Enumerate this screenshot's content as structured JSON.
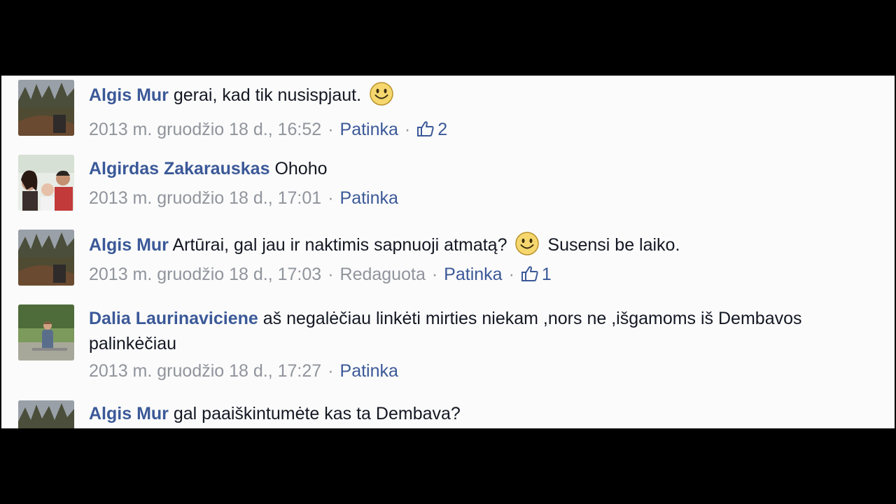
{
  "comments": [
    {
      "author": "Algis Mur",
      "text": "gerai, kad tik nusispjaut.",
      "has_smiley": true,
      "timestamp": "2013 m. gruodžio 18 d., 16:52",
      "like_label": "Patinka",
      "like_count": "2"
    },
    {
      "author": "Algirdas Zakarauskas",
      "text": "Ohoho",
      "timestamp": "2013 m. gruodžio 18 d., 17:01",
      "like_label": "Patinka"
    },
    {
      "author": "Algis Mur",
      "text_before": "Artūrai, gal jau ir naktimis sapnuoji atmatą?",
      "text_after": "Susensi be laiko.",
      "timestamp": "2013 m. gruodžio 18 d., 17:03",
      "edited_label": "Redaguota",
      "like_label": "Patinka",
      "like_count": "1"
    },
    {
      "author": "Dalia Laurinaviciene",
      "text": "aš negalėčiau linkėti mirties niekam ,nors ne ,išgamoms iš Dembavos palinkėčiau",
      "timestamp": "2013 m. gruodžio 18 d., 17:27",
      "like_label": "Patinka"
    },
    {
      "author": "Algis Mur",
      "text": "gal paaiškintumėte kas ta Dembava?"
    }
  ],
  "icons": {
    "smiley": "smiley-emoticon-icon",
    "like": "thumbs-up-icon"
  },
  "colors": {
    "author_link": "#3b5998",
    "meta_text": "#90949c",
    "background": "#fbfbfb"
  }
}
